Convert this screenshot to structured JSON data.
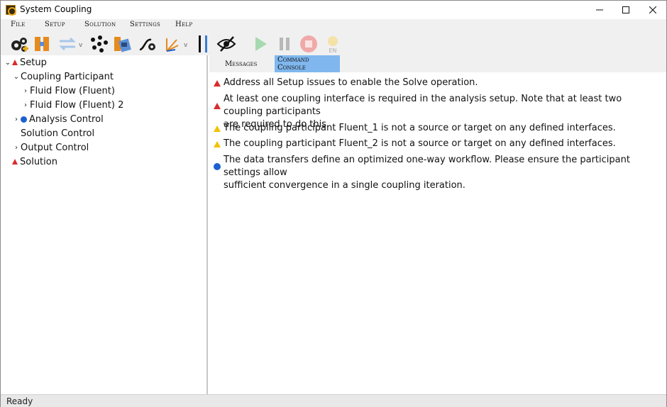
{
  "window": {
    "title": "System Coupling"
  },
  "menu": {
    "file": "File",
    "setup": "Setup",
    "solution": "Solution",
    "settings": "Settings",
    "help": "Help"
  },
  "toolbar": {
    "icons": [
      "gears-icon",
      "participant-add-icon",
      "data-transfer-icon",
      "mesh-points-icon",
      "participant-file-icon",
      "curve-settings-icon",
      "axis-transform-icon",
      "console-divider-icon",
      "visibility-toggle-icon",
      "run-icon",
      "pause-icon",
      "stop-icon",
      "language-icon"
    ],
    "language_label": "EN"
  },
  "tree": {
    "setup": "Setup",
    "coupling_participant": "Coupling Participant",
    "fluid_flow_1": "Fluid Flow (Fluent)",
    "fluid_flow_2": "Fluid Flow (Fluent) 2",
    "analysis_control": "Analysis Control",
    "solution_control": "Solution Control",
    "output_control": "Output Control",
    "solution": "Solution"
  },
  "tabs": {
    "messages": "Messages",
    "command_console": "Command Console"
  },
  "messages": [
    {
      "level": "error",
      "text": "Address all Setup issues to enable the Solve operation."
    },
    {
      "level": "error",
      "text": "At least one coupling interface is required in the analysis setup. Note that at least two coupling participants\nare required to do this."
    },
    {
      "level": "warning",
      "text": "The coupling participant Fluent_1 is not a source or target on any defined interfaces."
    },
    {
      "level": "warning",
      "text": "The coupling participant Fluent_2 is not a source or target on any defined interfaces."
    },
    {
      "level": "info",
      "text": "The data transfers define an optimized one-way workflow. Please ensure the participant settings allow\nsufficient convergence in a single coupling iteration."
    }
  ],
  "status": {
    "text": "Ready"
  },
  "colors": {
    "error": "#d92b2b",
    "warning": "#f2c200",
    "info": "#1d5fd1",
    "active_tab": "#7fb7ee"
  }
}
